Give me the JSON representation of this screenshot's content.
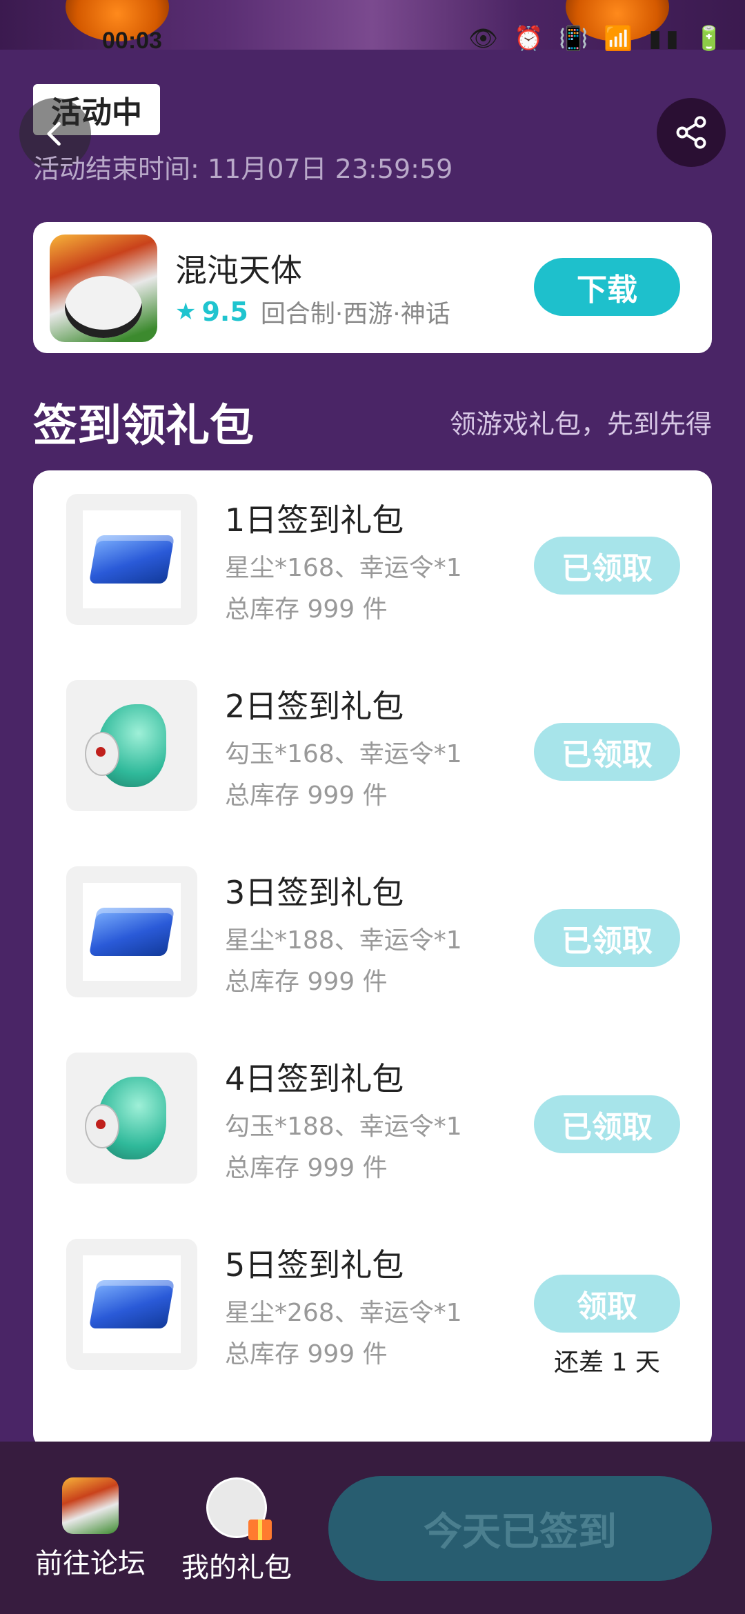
{
  "status_bar": {
    "time": "00:03",
    "icons": "👁 ⏰ 📳 📶 ▮▮ 🔋"
  },
  "header": {
    "badge": "活动中",
    "end_time": "活动结束时间: 11月07日 23:59:59"
  },
  "game": {
    "name": "混沌天体",
    "rating": "9.5",
    "tags": "回合制·西游·神话",
    "download_label": "下载"
  },
  "section": {
    "title": "签到领礼包",
    "subtitle": "领游戏礼包，先到先得"
  },
  "gifts": [
    {
      "title": "1日签到礼包",
      "desc": "星尘*168、幸运令*1",
      "stock": "总库存 999 件",
      "button": "已领取",
      "icon": "chest-icon"
    },
    {
      "title": "2日签到礼包",
      "desc": "勾玉*168、幸运令*1",
      "stock": "总库存 999 件",
      "button": "已领取",
      "icon": "jade-icon"
    },
    {
      "title": "3日签到礼包",
      "desc": "星尘*188、幸运令*1",
      "stock": "总库存 999 件",
      "button": "已领取",
      "icon": "chest-icon"
    },
    {
      "title": "4日签到礼包",
      "desc": "勾玉*188、幸运令*1",
      "stock": "总库存 999 件",
      "button": "已领取",
      "icon": "jade-icon"
    },
    {
      "title": "5日签到礼包",
      "desc": "星尘*268、幸运令*1",
      "stock": "总库存 999 件",
      "button": "领取",
      "remaining": "还差 1 天",
      "icon": "chest-icon"
    }
  ],
  "bottom": {
    "forum_label": "前往论坛",
    "my_gift_label": "我的礼包",
    "checkin_label": "今天已签到"
  },
  "colors": {
    "accent": "#1ec0cc",
    "background": "#4a2566",
    "claimed_button": "#a7e4ea",
    "bottom_bar": "#371c3f"
  }
}
